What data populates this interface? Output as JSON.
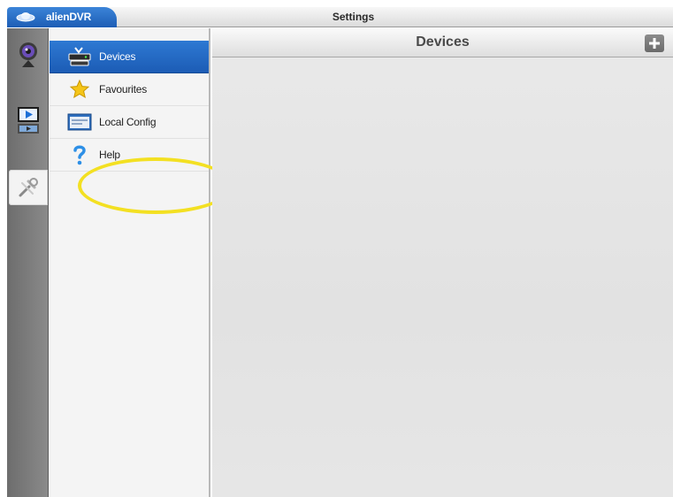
{
  "app_tab": {
    "label": "alienDVR",
    "logo_icon": "aliendvr-logo-icon"
  },
  "window": {
    "title": "Settings"
  },
  "dock": {
    "items": [
      {
        "icon": "camera-icon",
        "active": false
      },
      {
        "icon": "playback-icon",
        "active": false
      },
      {
        "icon": "settings-tools-icon",
        "active": true
      }
    ]
  },
  "settings_list": {
    "items": [
      {
        "label": "Devices",
        "icon": "devices-icon",
        "selected": true
      },
      {
        "label": "Favourites",
        "icon": "star-icon",
        "selected": false
      },
      {
        "label": "Local Config",
        "icon": "local-config-icon",
        "selected": false
      },
      {
        "label": "Help",
        "icon": "help-icon",
        "selected": false
      }
    ]
  },
  "main": {
    "title": "Devices",
    "add_icon": "plus-icon"
  },
  "colors": {
    "accent_blue": "#1d5db5",
    "highlight_yellow": "#f3e022"
  }
}
